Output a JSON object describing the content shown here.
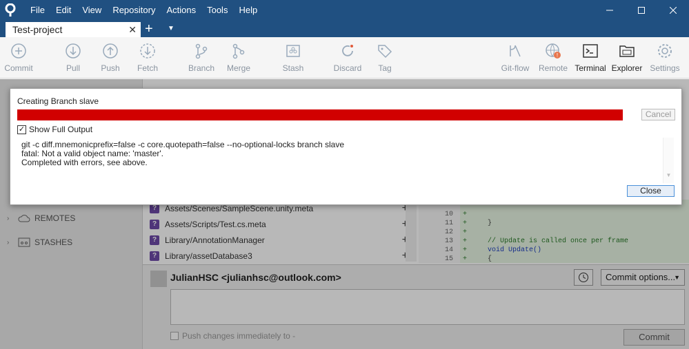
{
  "app": {
    "menu": [
      "File",
      "Edit",
      "View",
      "Repository",
      "Actions",
      "Tools",
      "Help"
    ],
    "tab_title": "Test-project"
  },
  "toolbar": {
    "commit": "Commit",
    "pull": "Pull",
    "push": "Push",
    "fetch": "Fetch",
    "branch": "Branch",
    "merge": "Merge",
    "stash": "Stash",
    "discard": "Discard",
    "tag": "Tag",
    "gitflow": "Git-flow",
    "remote": "Remote",
    "terminal": "Terminal",
    "explorer": "Explorer",
    "settings": "Settings"
  },
  "sidebar": {
    "remotes": "REMOTES",
    "stashes": "STASHES"
  },
  "files": [
    "Assets/Scenes/SampleScene.unity.meta",
    "Assets/Scripts/Test.cs.meta",
    "Library/AnnotationManager",
    "Library/assetDatabase3"
  ],
  "diff": [
    {
      "ln": "10",
      "code": "",
      "kind": "plain"
    },
    {
      "ln": "11",
      "code": "}",
      "kind": "plain"
    },
    {
      "ln": "12",
      "code": "",
      "kind": "plain"
    },
    {
      "ln": "13",
      "code": "// Update is called once per frame",
      "kind": "comment"
    },
    {
      "ln": "14",
      "code": "void Update()",
      "kind": "kw"
    },
    {
      "ln": "15",
      "code": "{",
      "kind": "plain"
    }
  ],
  "commit": {
    "author": "JulianHSC <julianhsc@outlook.com>",
    "options": "Commit options...",
    "push_label": "Push changes immediately to -",
    "button": "Commit"
  },
  "dialog": {
    "title": "Creating Branch  slave",
    "progress": 1.0,
    "progress_color": "#d10000",
    "cancel": "Cancel",
    "show_full": "Show Full Output",
    "output": [
      "git -c diff.mnemonicprefix=false -c core.quotepath=false --no-optional-locks branch slave",
      "fatal: Not a valid object name: 'master'.",
      "Completed with errors, see above."
    ],
    "close": "Close"
  }
}
